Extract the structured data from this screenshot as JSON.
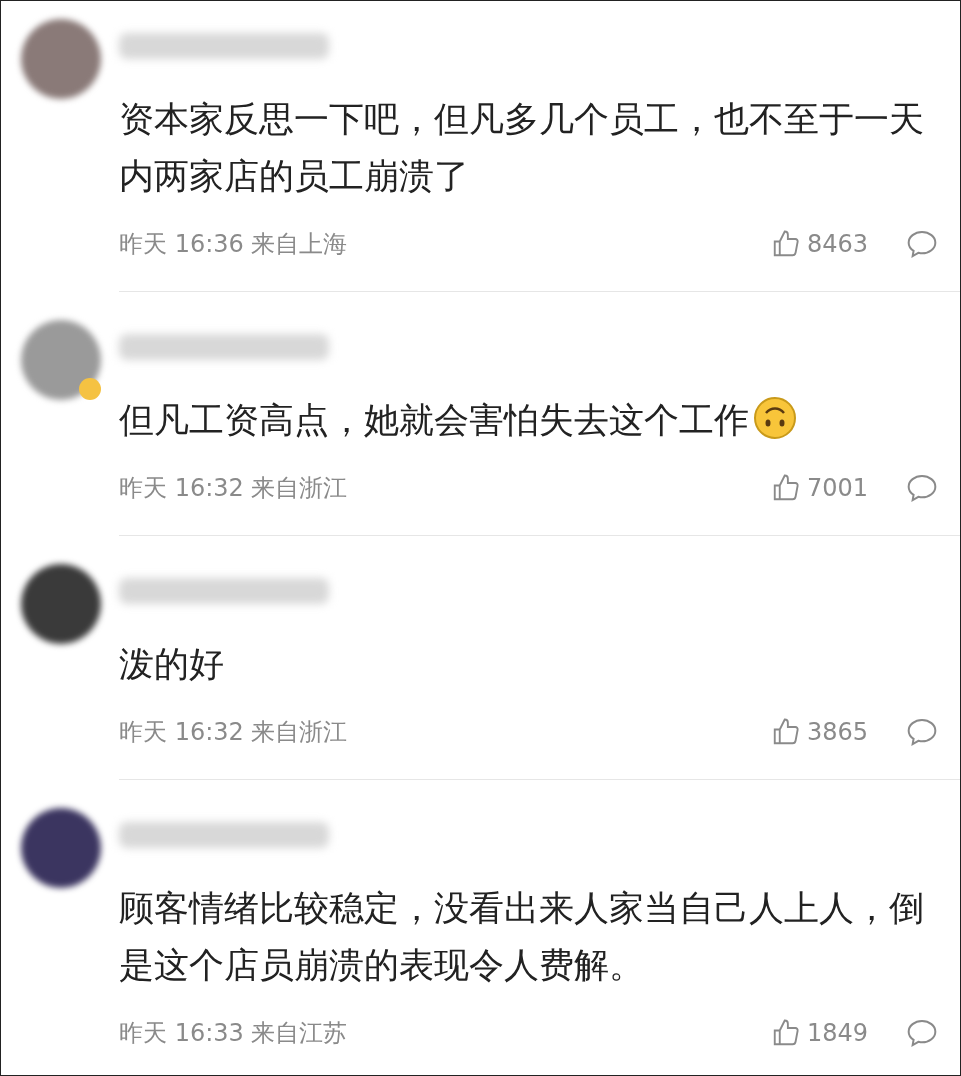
{
  "comments": [
    {
      "color": "#8a7a78",
      "verified": false,
      "text": "资本家反思一下吧，但凡多几个员工，也不至于一天内两家店的员工崩溃了",
      "emoji": false,
      "time": "昨天 16:36",
      "location": "来自上海",
      "likes": "8463"
    },
    {
      "color": "#9a9a9a",
      "verified": true,
      "text": "但凡工资高点，她就会害怕失去这个工作",
      "emoji": true,
      "time": "昨天 16:32",
      "location": "来自浙江",
      "likes": "7001"
    },
    {
      "color": "#3a3a3a",
      "verified": false,
      "text": "泼的好",
      "emoji": false,
      "time": "昨天 16:32",
      "location": "来自浙江",
      "likes": "3865"
    },
    {
      "color": "#3b3560",
      "verified": false,
      "text": "顾客情绪比较稳定，没看出来人家当自己人上人，倒是这个店员崩溃的表现令人费解。",
      "emoji": false,
      "time": "昨天 16:33",
      "location": "来自江苏",
      "likes": "1849"
    }
  ]
}
